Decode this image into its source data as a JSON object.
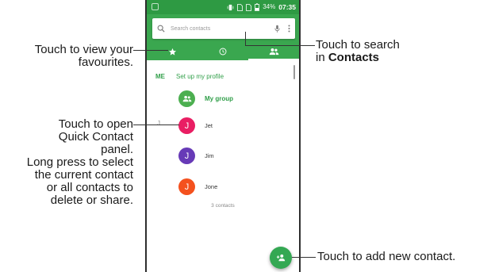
{
  "status_bar": {
    "battery": "34%",
    "time": "07:35",
    "icons": [
      "vibrate-icon",
      "sim1-icon",
      "sim2-icon",
      "signal-icon",
      "battery-icon"
    ]
  },
  "search": {
    "placeholder": "Search contacts",
    "icons": [
      "search-icon",
      "mic-icon",
      "more-vert-icon"
    ]
  },
  "tabs": [
    {
      "name": "favourites",
      "icon": "star-icon",
      "active": false
    },
    {
      "name": "recents",
      "icon": "clock-icon",
      "active": false
    },
    {
      "name": "contacts",
      "icon": "people-icon",
      "active": true
    }
  ],
  "contacts_list": {
    "me_label": "ME",
    "profile_label": "Set up my profile",
    "group_label": "My group",
    "section_letter": "J",
    "contacts": [
      {
        "name": "Jet",
        "initial": "J",
        "color": "#e91e63"
      },
      {
        "name": "Jim",
        "initial": "J",
        "color": "#673ab7"
      },
      {
        "name": "Jone",
        "initial": "J",
        "color": "#f4511e"
      }
    ],
    "count_text": "3 contacts"
  },
  "colors": {
    "status_bar": "#2e9a43",
    "header": "#3aa74f",
    "accent_green": "#33a04b",
    "fab": "#34a853"
  },
  "callouts": {
    "favourites_line1": "Touch to view your",
    "favourites_line2": "favourites.",
    "search_line1": "Touch to search",
    "search_line2_prefix": "in ",
    "search_line2_bold": "Contacts",
    "quick_line1": "Touch to open",
    "quick_line2": "Quick Contact",
    "quick_line3": "panel.",
    "long_line1": "Long press to select",
    "long_line2": "the current contact",
    "long_line3": "or all contacts to",
    "long_line4": "delete or share.",
    "add": "Touch to add new contact."
  }
}
